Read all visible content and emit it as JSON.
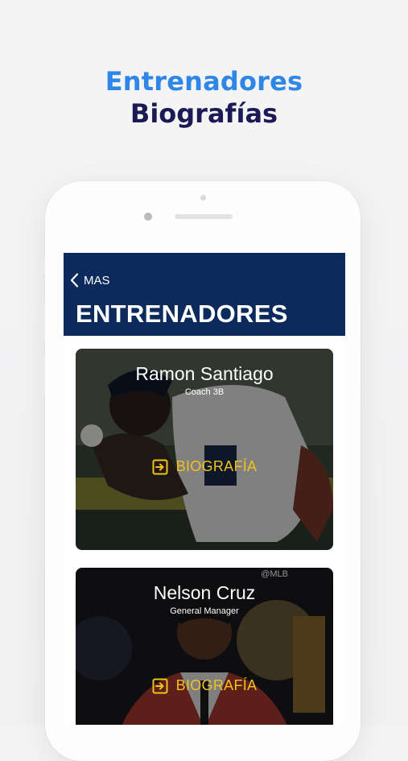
{
  "promo": {
    "line1": "Entrenadores",
    "line2": "Biografías"
  },
  "navbar": {
    "back_label": "MAS",
    "title": "ENTRENADORES"
  },
  "coaches": [
    {
      "name": "Ramon Santiago",
      "role": "Coach 3B",
      "bio_label": "BIOGRAFÍA"
    },
    {
      "name": "Nelson Cruz",
      "role": "General Manager",
      "bio_label": "BIOGRAFÍA",
      "watermark": "@MLB"
    }
  ],
  "colors": {
    "accent_blue": "#2e86e6",
    "heading_navy": "#1b1a55",
    "navbar_bg": "#0c2a5b",
    "bio_yellow": "#f2c21a"
  },
  "icons": {
    "back": "chevron-left-icon",
    "bio": "enter-arrow-icon"
  }
}
